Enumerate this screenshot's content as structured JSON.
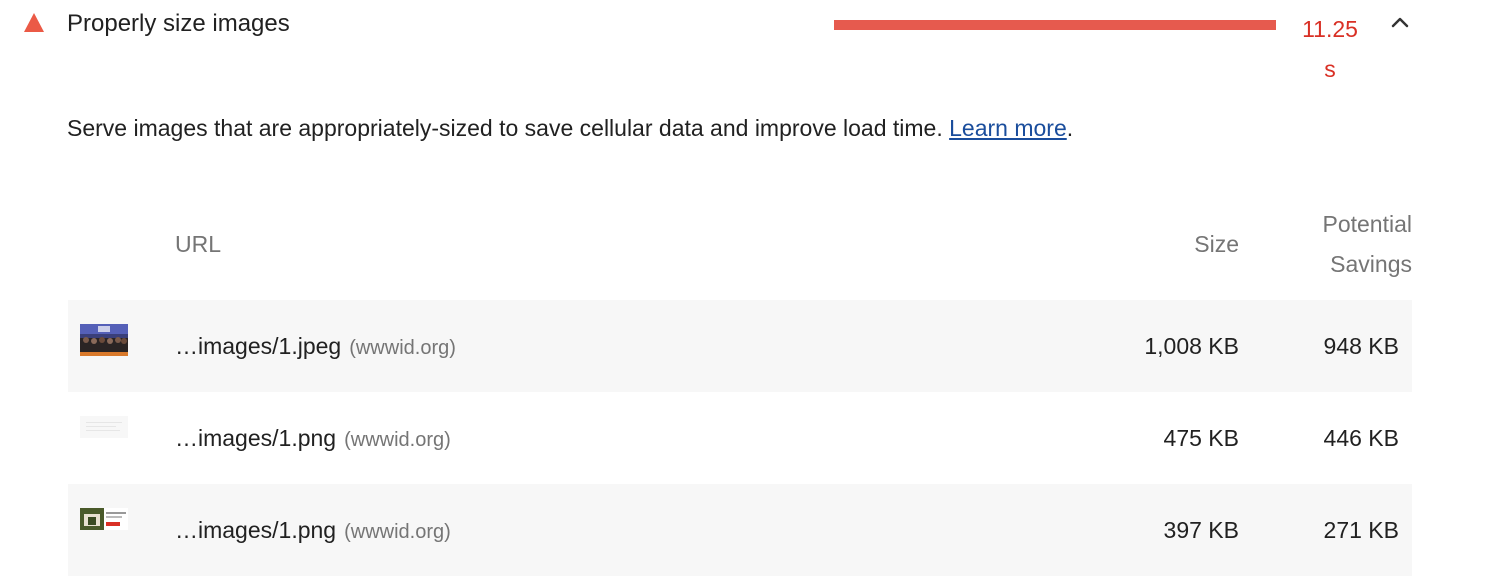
{
  "audit": {
    "title": "Properly size images",
    "savings_value": "11.25 s",
    "savings_fraction": 1.0,
    "status_color": "#eb5a46",
    "status_icon": "warning-triangle-icon",
    "expand_icon": "chevron-up-icon"
  },
  "description": {
    "text": "Serve images that are appropriately-sized to save cellular data and improve load time.",
    "link_label": "Learn more",
    "suffix": "."
  },
  "table": {
    "headers": {
      "url": "URL",
      "size": "Size",
      "savings": "Potential Savings"
    },
    "rows": [
      {
        "url": "…images/1.jpeg",
        "origin": "(wwwid.org)",
        "size": "1,008 KB",
        "savings": "948 KB",
        "thumb": "photo-thumbnail"
      },
      {
        "url": "…images/1.png",
        "origin": "(wwwid.org)",
        "size": "475 KB",
        "savings": "446 KB",
        "thumb": "blank-thumbnail"
      },
      {
        "url": "…images/1.png",
        "origin": "(wwwid.org)",
        "size": "397 KB",
        "savings": "271 KB",
        "thumb": "banner-thumbnail"
      }
    ]
  }
}
